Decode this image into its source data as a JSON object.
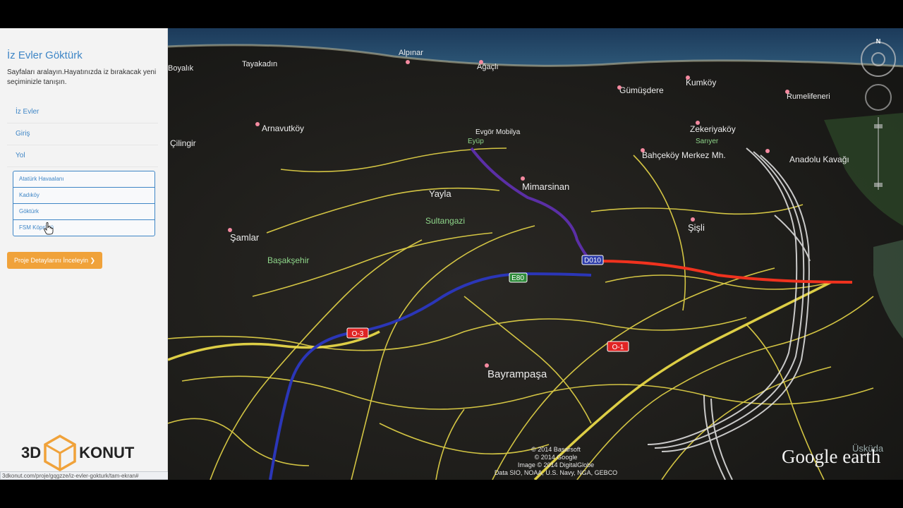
{
  "sidebar": {
    "title": "İz Evler Göktürk",
    "description": "Sayfaları aralayın.Hayatınızda iz bırakacak yeni seçiminizle tanışın.",
    "nav": [
      "İz Evler",
      "Giriş",
      "Yol"
    ],
    "subnav": [
      "Atatürk Havaalanı",
      "Kadıköy",
      "Göktürk",
      "FSM Köprüsü"
    ],
    "cta_label": "Proje Detaylarını İnceleyin ❯",
    "logo_prefix": "3D",
    "logo_suffix": "KONUT"
  },
  "status_bar": {
    "url": "3dkonut.com/proje/gqgzze/iz-evler-gokturk/tam-ekran#"
  },
  "map": {
    "place_labels": {
      "alpinar": "Alpınar",
      "boyalik": "Boyalık",
      "tayakadin": "Tayakadın",
      "agacli": "Ağaçlı",
      "gumusdere": "Gümüşdere",
      "kumkoy": "Kumköy",
      "rumelifeneri": "Rumelifeneri",
      "arnavutkoy": "Arnavutköy",
      "evgor": "Evgör Mobilya",
      "eyup": "Eyüp",
      "zekeriyakoy": "Zekeriyaköy",
      "sariyer": "Sarıyer",
      "cilingir": "Çilingir",
      "bahcekoy": "Bahçeköy Merkez Mh.",
      "anadolu": "Anadolu Kavağı",
      "yayla": "Yayla",
      "mimarsinan": "Mimarsinan",
      "sultangazi": "Sultangazi",
      "samlar": "Şamlar",
      "sisli": "Şişli",
      "basaksehir": "Başakşehir",
      "bayrampasa": "Bayrampaşa",
      "uskudar": "Üsküda"
    },
    "road_shields": {
      "d010": "D010",
      "e80": "E80",
      "o3": "O-3",
      "o1": "O-1"
    },
    "compass_letter": "N",
    "attribution": [
      "© 2014 Basarsoft",
      "© 2014 Google",
      "Image © 2014 DigitalGlobe",
      "Data SIO, NOAA, U.S. Navy, NGA, GEBCO"
    ],
    "brand": "Google earth",
    "colors": {
      "route_purple": "#5b2fa6",
      "route_blue": "#2b36b8",
      "route_red": "#f0321e",
      "roads": "#f2e14a",
      "accent": "#3f86c6",
      "cta": "#f0a23a"
    }
  }
}
